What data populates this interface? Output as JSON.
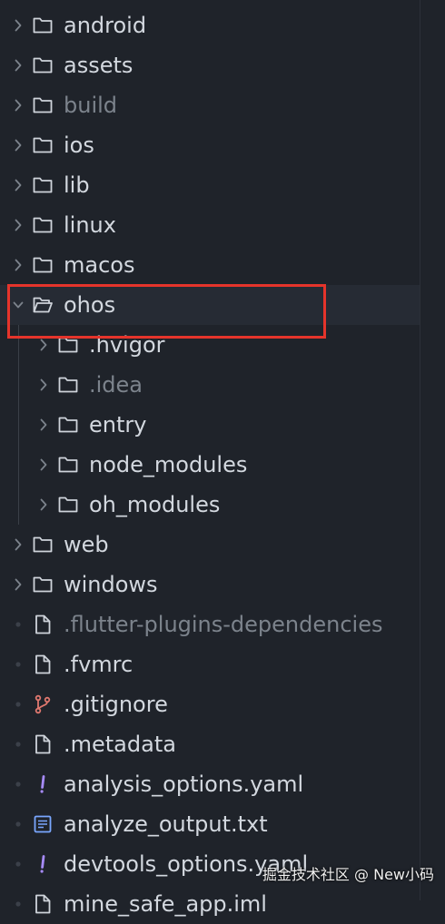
{
  "colors": {
    "background": "#1f232a",
    "selected_row": "#262b34",
    "text": "#d3d8df",
    "text_dimmed": "#7c838c",
    "folder_icon": "#cfd4db",
    "git_icon": "#e0786f",
    "yaml_icon": "#a78bfa",
    "txt_icon": "#7aa7ff",
    "highlight_border": "#e5342b"
  },
  "tree": {
    "items": [
      {
        "name": "android",
        "kind": "folder",
        "level": 0,
        "expanded": false,
        "dimmed": false
      },
      {
        "name": "assets",
        "kind": "folder",
        "level": 0,
        "expanded": false,
        "dimmed": false
      },
      {
        "name": "build",
        "kind": "folder",
        "level": 0,
        "expanded": false,
        "dimmed": true
      },
      {
        "name": "ios",
        "kind": "folder",
        "level": 0,
        "expanded": false,
        "dimmed": false
      },
      {
        "name": "lib",
        "kind": "folder",
        "level": 0,
        "expanded": false,
        "dimmed": false
      },
      {
        "name": "linux",
        "kind": "folder",
        "level": 0,
        "expanded": false,
        "dimmed": false
      },
      {
        "name": "macos",
        "kind": "folder",
        "level": 0,
        "expanded": false,
        "dimmed": false
      },
      {
        "name": "ohos",
        "kind": "folder",
        "level": 0,
        "expanded": true,
        "dimmed": false,
        "selected": true,
        "highlighted": true
      },
      {
        "name": ".hvigor",
        "kind": "folder",
        "level": 1,
        "expanded": false,
        "dimmed": false
      },
      {
        "name": ".idea",
        "kind": "folder",
        "level": 1,
        "expanded": false,
        "dimmed": true
      },
      {
        "name": "entry",
        "kind": "folder",
        "level": 1,
        "expanded": false,
        "dimmed": false
      },
      {
        "name": "node_modules",
        "kind": "folder",
        "level": 1,
        "expanded": false,
        "dimmed": false
      },
      {
        "name": "oh_modules",
        "kind": "folder",
        "level": 1,
        "expanded": false,
        "dimmed": false
      },
      {
        "name": "web",
        "kind": "folder",
        "level": 0,
        "expanded": false,
        "dimmed": false
      },
      {
        "name": "windows",
        "kind": "folder",
        "level": 0,
        "expanded": false,
        "dimmed": false
      },
      {
        "name": ".flutter-plugins-dependencies",
        "kind": "file",
        "icon": "file-icon",
        "level": 0,
        "dimmed": true
      },
      {
        "name": ".fvmrc",
        "kind": "file",
        "icon": "file-icon",
        "level": 0,
        "dimmed": false
      },
      {
        "name": ".gitignore",
        "kind": "file",
        "icon": "git-branch-icon",
        "level": 0,
        "dimmed": false
      },
      {
        "name": ".metadata",
        "kind": "file",
        "icon": "file-icon",
        "level": 0,
        "dimmed": false
      },
      {
        "name": "analysis_options.yaml",
        "kind": "file",
        "icon": "yaml-exclamation-icon",
        "level": 0,
        "dimmed": false
      },
      {
        "name": "analyze_output.txt",
        "kind": "file",
        "icon": "text-file-icon",
        "level": 0,
        "dimmed": false
      },
      {
        "name": "devtools_options.yaml",
        "kind": "file",
        "icon": "yaml-exclamation-icon",
        "level": 0,
        "dimmed": false
      },
      {
        "name": "mine_safe_app.iml",
        "kind": "file",
        "icon": "file-icon",
        "level": 0,
        "dimmed": false
      }
    ]
  },
  "watermark": "掘金技术社区 @ New小码"
}
